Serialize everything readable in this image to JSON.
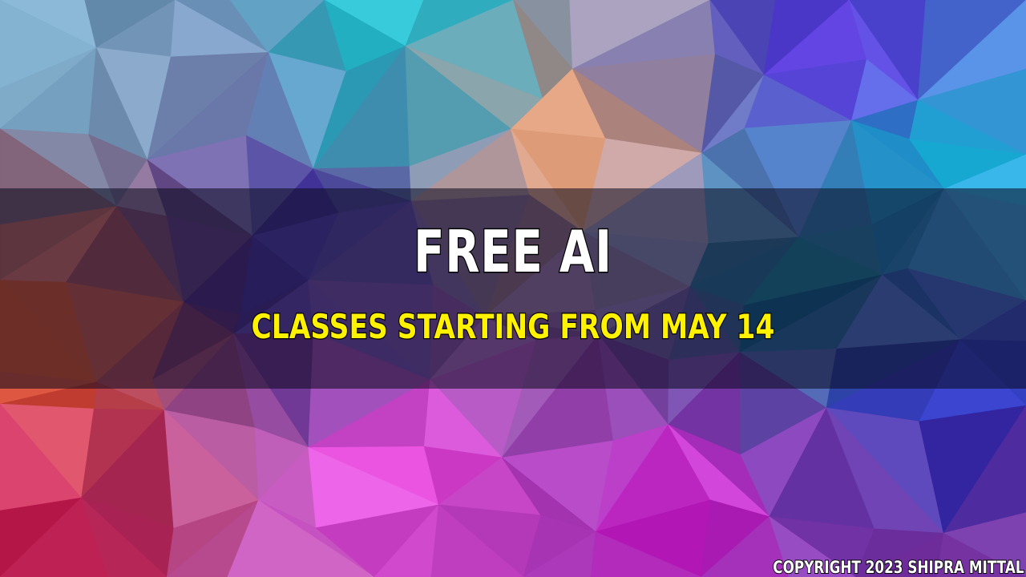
{
  "banner": {
    "title": "FREE AI",
    "subtitle": "CLASSES STARTING FROM MAY 14",
    "copyright": "COPYRIGHT 2023 SHIPRA MITTAL"
  },
  "colors": {
    "title_text": "#ffffff",
    "subtitle_text": "#fff200",
    "text_outline": "#000000",
    "band": "rgba(10,10,30,0.55)",
    "palette": [
      "#2cc4d6",
      "#1fb6e0",
      "#6a6ad8",
      "#8a3fc8",
      "#c03ad0",
      "#e84fe0",
      "#f49a7a",
      "#e0502c",
      "#3a2a9a",
      "#1a6ad8",
      "#5a2a8a",
      "#9a2a6a"
    ]
  }
}
